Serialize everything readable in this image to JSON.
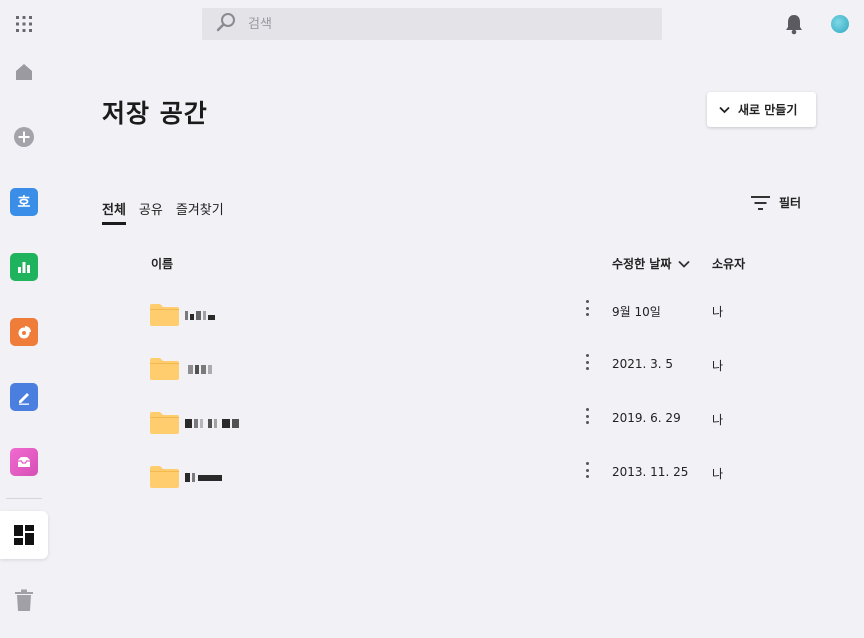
{
  "search": {
    "placeholder": "검색"
  },
  "page": {
    "title": "저장 공간"
  },
  "new_button": {
    "label": "새로 만들기"
  },
  "tabs": [
    {
      "label": "전체",
      "active": true
    },
    {
      "label": "공유",
      "active": false
    },
    {
      "label": "즐겨찾기",
      "active": false
    }
  ],
  "filter": {
    "label": "필터"
  },
  "table": {
    "columns": {
      "name": "이름",
      "modified": "수정한 날짜",
      "owner": "소유자"
    },
    "rows": [
      {
        "name": "(blurred)",
        "modified": "9월 10일",
        "owner": "나"
      },
      {
        "name": "(blurred)",
        "modified": "2021. 3. 5",
        "owner": "나"
      },
      {
        "name": "(blurred)",
        "modified": "2019. 6. 29",
        "owner": "나"
      },
      {
        "name": "(blurred)",
        "modified": "2013. 11. 25",
        "owner": "나"
      }
    ]
  },
  "rail": {
    "items": [
      "apps-grid-icon",
      "home-icon",
      "add-icon",
      "word-processor-app",
      "spreadsheet-app",
      "presentation-app",
      "notes-app",
      "mail-app",
      "drive-dashboard-icon",
      "trash-icon"
    ],
    "app_colors": {
      "word": "#3b8ee8",
      "sheet": "#1fb35e",
      "slide": "#f07c3a",
      "note": "#4a7fe0",
      "mail": "#e85fc2"
    },
    "word_glyph": "호"
  },
  "folder_color": "#ffcd6e"
}
